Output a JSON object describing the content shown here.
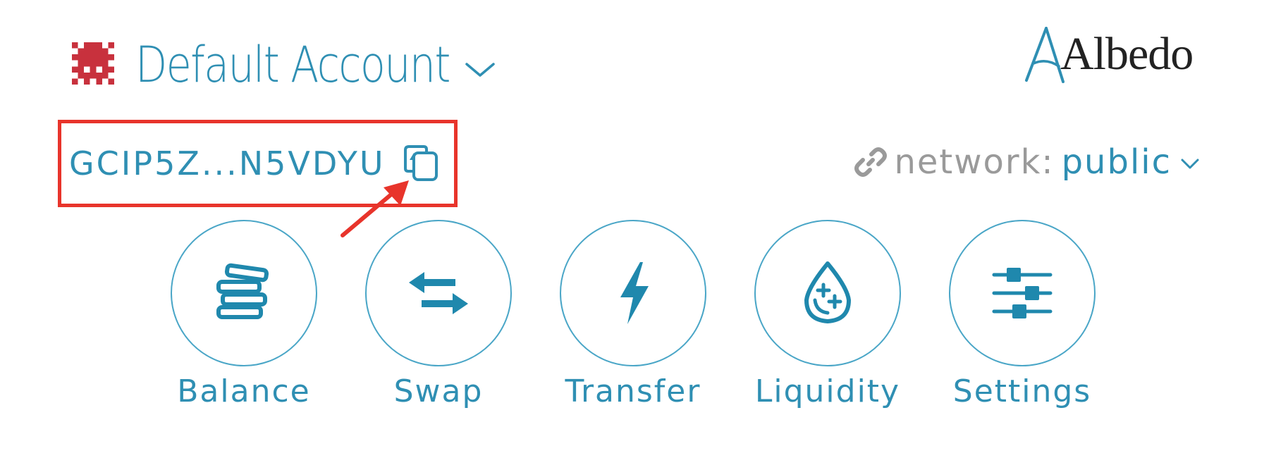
{
  "account": {
    "name": "Default Account",
    "address": "GCIP5Z...N5VDYU",
    "icons": {
      "avatar": "identicon-avatar",
      "chevron": "chevron-down-icon",
      "copy": "copy-icon"
    }
  },
  "brand": {
    "name": "Albedo"
  },
  "network": {
    "label": "network:",
    "value": "public",
    "icons": {
      "link": "link-icon",
      "chevron": "chevron-down-icon"
    }
  },
  "actions": [
    {
      "label": "Balance",
      "icon": "coins-stack-icon"
    },
    {
      "label": "Swap",
      "icon": "swap-arrows-icon"
    },
    {
      "label": "Transfer",
      "icon": "lightning-bolt-icon"
    },
    {
      "label": "Liquidity",
      "icon": "liquidity-drop-icon"
    },
    {
      "label": "Settings",
      "icon": "settings-sliders-icon"
    }
  ],
  "colors": {
    "accent": "#2f8fb3",
    "muted": "#9a9a9a",
    "identicon": "#c8313d",
    "annotation": "#e8342b",
    "logo_text": "#222222"
  }
}
